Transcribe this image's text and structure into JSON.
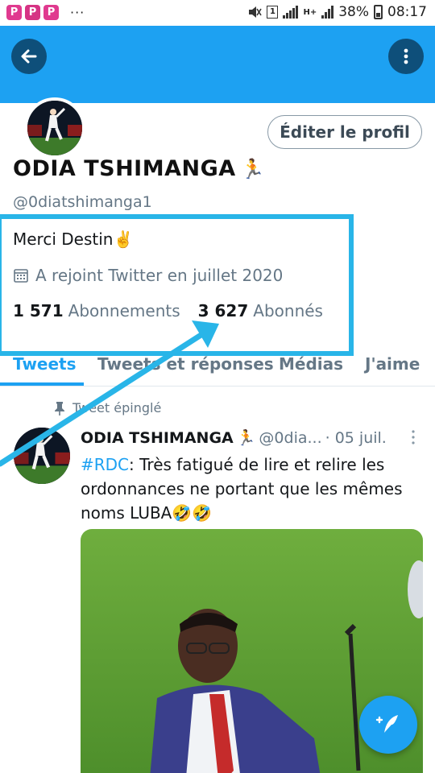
{
  "status_bar": {
    "app_icons": [
      "P",
      "P",
      "P"
    ],
    "dots": "···",
    "sim_badge": "1",
    "network": "H+",
    "battery": "38%",
    "time": "08:17"
  },
  "colors": {
    "twitter_blue": "#1da1f2",
    "banner": "#1da1f2",
    "highlight": "#29b5e8"
  },
  "profile": {
    "edit_label": "Éditer le profil",
    "display_name": "ODIA TSHIMANGA",
    "name_emoji": "🏃",
    "handle": "@0diatshimanga1",
    "bio": "Merci Destin✌️",
    "joined": "A rejoint Twitter en juillet 2020",
    "following_count": "1 571",
    "following_label": "Abonnements",
    "followers_count": "3 627",
    "followers_label": "Abonnés"
  },
  "tabs": [
    {
      "label": "Tweets",
      "active": true
    },
    {
      "label": "Tweets et réponses",
      "active": false
    },
    {
      "label": "Médias",
      "active": false
    },
    {
      "label": "J'aime",
      "active": false
    }
  ],
  "pinned_tweet": {
    "pinned_label": "Tweet épinglé",
    "author_name": "ODIA TSHIMANGA",
    "author_emoji": "🏃",
    "author_handle": "@0dia...",
    "date": "· 05 juil.",
    "hashtag": "#RDC",
    "text": ": Très fatigué de lire et relire les ordonnances ne portant  que les mêmes noms LUBA🤣🤣"
  },
  "icons": {
    "back": "arrow-left-icon",
    "more": "more-vertical-icon",
    "calendar": "calendar-icon",
    "pin": "pin-icon",
    "compose": "compose-tweet-icon"
  }
}
